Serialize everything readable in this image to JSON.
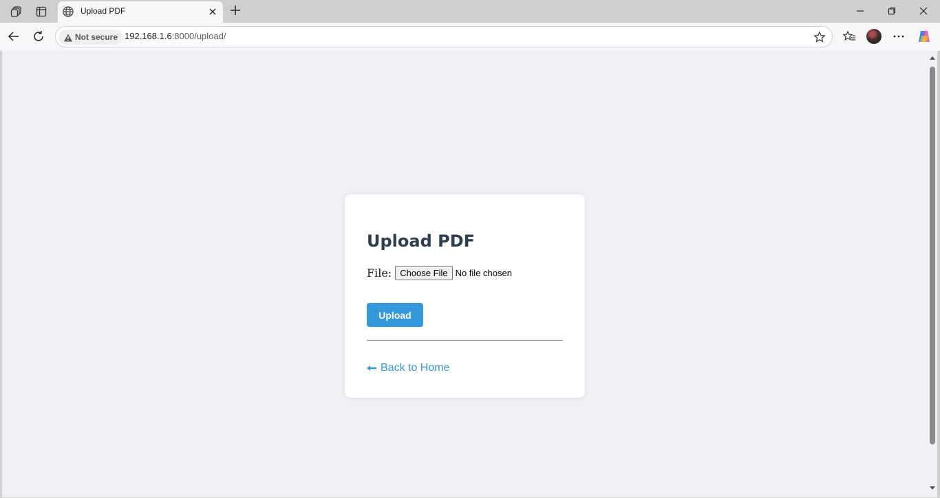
{
  "browser": {
    "tab": {
      "title": "Upload PDF"
    },
    "address": {
      "security_label": "Not secure",
      "host": "192.168.1.6",
      "path": ":8000/upload/"
    },
    "icons": {
      "workspaces": "workspaces-icon",
      "tab_actions": "vertical-tabs-icon",
      "tab_site": "globe-icon",
      "tab_close": "close-icon",
      "new_tab": "plus-icon",
      "back": "back-arrow-icon",
      "refresh": "refresh-icon",
      "warning": "warning-icon",
      "favorite": "star-icon",
      "favorites": "favorites-icon",
      "profile": "avatar",
      "more": "more-icon",
      "copilot": "copilot-icon",
      "minimize": "minimize-icon",
      "restore": "restore-icon",
      "close_window": "close-icon"
    }
  },
  "page": {
    "heading": "Upload PDF",
    "file_label": "File:",
    "choose_file_label": "Choose File",
    "no_file_text": "No file chosen",
    "upload_label": "Upload",
    "back_link": "Back to Home"
  },
  "colors": {
    "accent": "#3498db",
    "heading": "#2c3e50",
    "page_background": "#f0f1f4",
    "card_background": "#ffffff"
  }
}
